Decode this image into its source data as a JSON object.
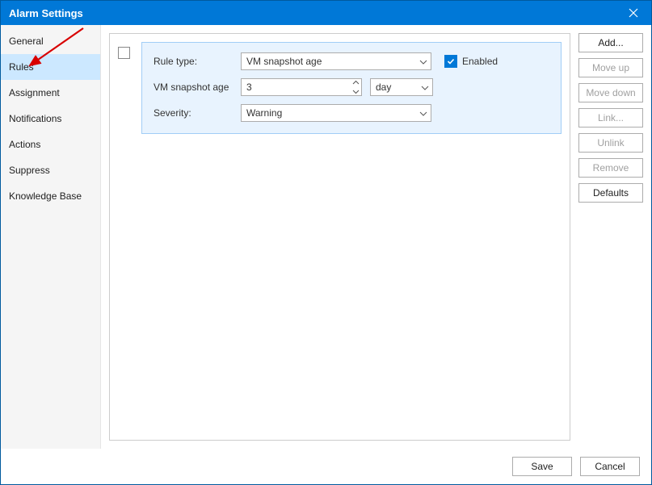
{
  "window": {
    "title": "Alarm Settings"
  },
  "sidebar": {
    "items": [
      {
        "label": "General"
      },
      {
        "label": "Rules"
      },
      {
        "label": "Assignment"
      },
      {
        "label": "Notifications"
      },
      {
        "label": "Actions"
      },
      {
        "label": "Suppress"
      },
      {
        "label": "Knowledge Base"
      }
    ],
    "selected_index": 1
  },
  "rule": {
    "labels": {
      "rule_type": "Rule type:",
      "snapshot_age": "VM snapshot age",
      "severity": "Severity:",
      "enabled": "Enabled"
    },
    "values": {
      "rule_type": "VM snapshot age",
      "snapshot_age_value": "3",
      "snapshot_age_unit": "day",
      "severity": "Warning",
      "enabled": true
    }
  },
  "side_buttons": [
    {
      "label": "Add...",
      "enabled": true
    },
    {
      "label": "Move up",
      "enabled": false
    },
    {
      "label": "Move down",
      "enabled": false
    },
    {
      "label": "Link...",
      "enabled": false
    },
    {
      "label": "Unlink",
      "enabled": false
    },
    {
      "label": "Remove",
      "enabled": false
    },
    {
      "label": "Defaults",
      "enabled": true
    }
  ],
  "footer": {
    "save": "Save",
    "cancel": "Cancel"
  },
  "colors": {
    "accent": "#0078d7",
    "selection": "#cce8ff",
    "card_bg": "#e8f3fe",
    "card_border": "#a1cdf6"
  }
}
